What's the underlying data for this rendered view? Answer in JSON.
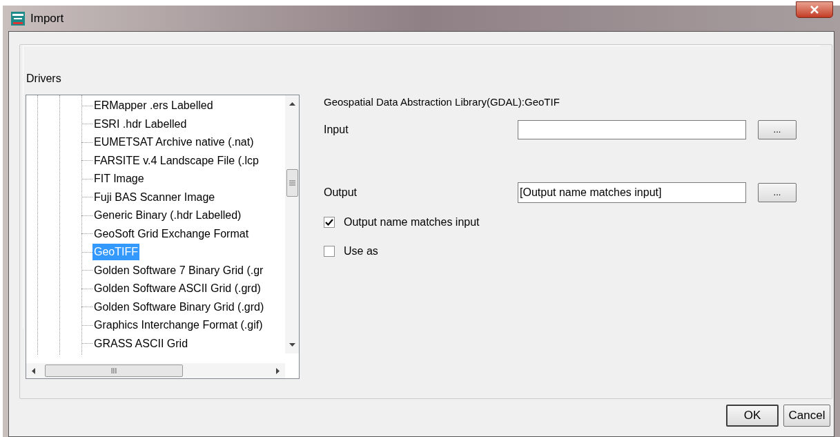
{
  "window": {
    "title": "Import"
  },
  "drivers": {
    "label": "Drivers",
    "items": [
      {
        "label": "ERMapper .ers Labelled",
        "selected": false
      },
      {
        "label": "ESRI .hdr Labelled",
        "selected": false
      },
      {
        "label": "EUMETSAT Archive native (.nat)",
        "selected": false
      },
      {
        "label": "FARSITE v.4 Landscape File (.lcp",
        "selected": false
      },
      {
        "label": "FIT Image",
        "selected": false
      },
      {
        "label": "Fuji BAS Scanner Image",
        "selected": false
      },
      {
        "label": "Generic Binary (.hdr Labelled)",
        "selected": false
      },
      {
        "label": "GeoSoft Grid Exchange Format",
        "selected": false
      },
      {
        "label": "GeoTIFF",
        "selected": true
      },
      {
        "label": "Golden Software 7 Binary Grid (.gr",
        "selected": false
      },
      {
        "label": "Golden Software ASCII Grid (.grd)",
        "selected": false
      },
      {
        "label": "Golden Software Binary Grid (.grd)",
        "selected": false
      },
      {
        "label": "Graphics Interchange Format (.gif)",
        "selected": false
      },
      {
        "label": "GRASS ASCII Grid",
        "selected": false
      }
    ],
    "scroll_thumb": "III"
  },
  "description": "Geospatial Data Abstraction Library(GDAL):GeoTIF",
  "input": {
    "label": "Input",
    "browse": "..."
  },
  "output": {
    "label": "Output",
    "value": "[Output name matches input]",
    "browse": "..."
  },
  "options": [
    {
      "label": "Output name matches input",
      "checked": true
    },
    {
      "label": "Use as",
      "checked": false
    }
  ],
  "buttons": [
    "OK",
    "Cancel"
  ]
}
